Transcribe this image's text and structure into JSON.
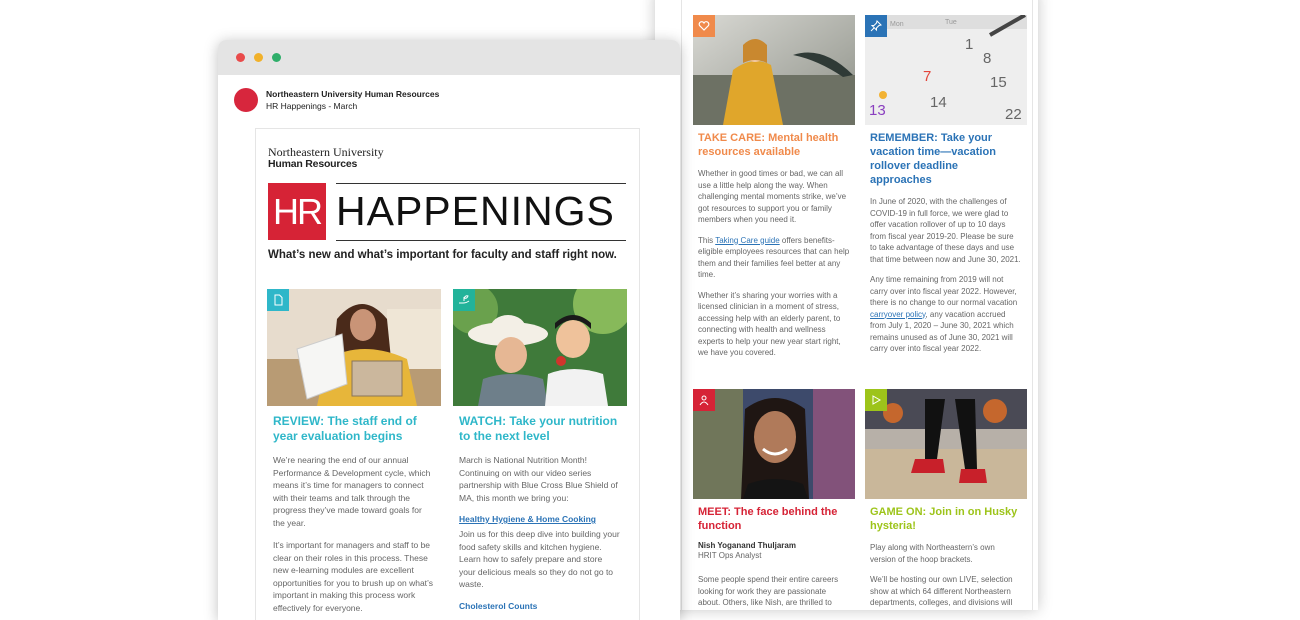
{
  "colors": {
    "teal": "#2fb7c9",
    "orange": "#f08a4b",
    "blue": "#2b73b6",
    "red": "#d62336",
    "lime": "#9dc41a",
    "green_badge": "#22b39a"
  },
  "email": {
    "from": "Northeastern University Human Resources",
    "subject": "HR Happenings - March"
  },
  "newsletter": {
    "brand_line1": "Northeastern University",
    "brand_line2": "Human Resources",
    "hr_mark": "HR",
    "title": "HAPPENINGS",
    "tagline": "What’s new and what’s important for faculty and staff right now."
  },
  "front_cards": [
    {
      "icon": "document-icon",
      "title": "REVIEW: The staff end of year evaluation begins",
      "paragraphs": [
        "We’re nearing the end of our annual Performance & Development cycle, which means it’s time for managers to connect with their teams and talk through the progress they’ve made toward goals for the year.",
        "It’s important for managers and staff to be clear on their roles in this process. These new e-learning modules are excellent opportunities for you to brush up on what’s important in making this process work effectively for everyone."
      ]
    },
    {
      "icon": "plant-hand-icon",
      "title": "WATCH: Take your nutrition to the next level",
      "paragraphs": [
        "March is National Nutrition Month! Continuing on with our video series partnership with Blue Cross Blue Shield of MA, this month we bring you:"
      ],
      "link1": "Healthy Hygiene & Home Cooking",
      "paragraph2": "Join us for this deep dive into building your food safety skills and kitchen hygiene. Learn how to safely prepare and store your delicious meals so they do not go to waste.",
      "link2": "Cholesterol Counts"
    }
  ],
  "back_cards": [
    {
      "icon": "heart-icon",
      "title": "TAKE CARE: Mental health resources available",
      "p1": "Whether in good times or bad, we can all use a little help along the way. When challenging mental moments strike, we’ve got resources to support you or family members when you need it.",
      "p2_pre": "This ",
      "p2_link": "Taking Care guide",
      "p2_post": " offers benefits-eligible employees resources that can help them and their families feel better at any time.",
      "p3": "Whether it’s sharing your worries with a licensed clinician in a moment of stress, accessing help with an elderly parent, to connecting with health and wellness experts to help your new year start right, we have you covered."
    },
    {
      "icon": "pushpin-icon",
      "title": "REMEMBER: Take your vacation time—vacation rollover deadline approaches",
      "p1": "In June of 2020, with the challenges of COVID-19 in full force, we were glad to offer vacation rollover of up to 10 days from fiscal year 2019-20. Please be sure to take advantage of these days and use that time between now and June 30, 2021.",
      "p2_pre": "Any time remaining from 2019 will not carry over into fiscal year 2022. However, there is no change to our normal vacation ",
      "p2_link": "carryover policy",
      "p2_post": ", any vacation accrued from July 1, 2020 – June 30, 2021 which remains unused as of June 30, 2021 will carry over into fiscal year 2022."
    },
    {
      "icon": "person-icon",
      "title": "MEET: The face behind the function",
      "name": "Nish Yoganand Thuljaram",
      "role": "HRIT Ops Analyst",
      "p1": "Some people spend their entire careers looking for work they are passionate about. Others, like Nish, are thrilled to"
    },
    {
      "icon": "play-icon",
      "title": "GAME ON: Join in on Husky hysteria!",
      "p1": "Play along with Northeastern’s own version of the hoop brackets.",
      "p2": "We’ll be hosting our own LIVE, selection show at which 64 different Northeastern departments, colleges, and divisions will"
    }
  ],
  "calendar_numbers": [
    "1",
    "8",
    "15",
    "7",
    "14",
    "13",
    "22"
  ],
  "calendar_days": [
    "Mon",
    "Tue"
  ]
}
